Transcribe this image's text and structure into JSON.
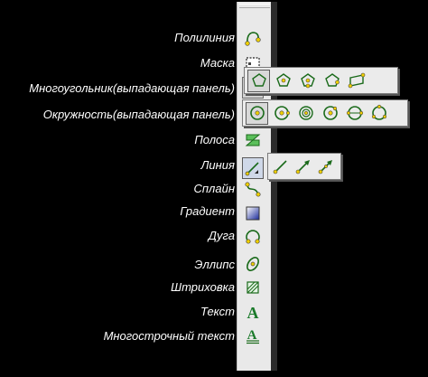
{
  "tools": [
    {
      "label": "Полилиния",
      "icon": "polyline-icon"
    },
    {
      "label": "Маска",
      "icon": "mask-icon"
    },
    {
      "label": "Многоугольник(выпадающая панель)",
      "icon": "polygon-icon"
    },
    {
      "label": "Окружность(выпадающая панель)",
      "icon": "circle-icon"
    },
    {
      "label": "Полоса",
      "icon": "strip-icon"
    },
    {
      "label": "Линия",
      "icon": "line-icon"
    },
    {
      "label": "Сплайн",
      "icon": "spline-icon"
    },
    {
      "label": "Градиент",
      "icon": "gradient-icon"
    },
    {
      "label": "Дуга",
      "icon": "arc-icon"
    },
    {
      "label": "Эллипс",
      "icon": "ellipse-icon"
    },
    {
      "label": "Штриховка",
      "icon": "hatch-icon"
    },
    {
      "label": "Текст",
      "icon": "text-icon"
    },
    {
      "label": "Многострочный текст",
      "icon": "multiline-text-icon"
    }
  ],
  "colors": {
    "icon_stroke": "#1a6a1a",
    "node": "#f0d000",
    "background": "#000000",
    "toolbar": "#e9e9e9"
  }
}
